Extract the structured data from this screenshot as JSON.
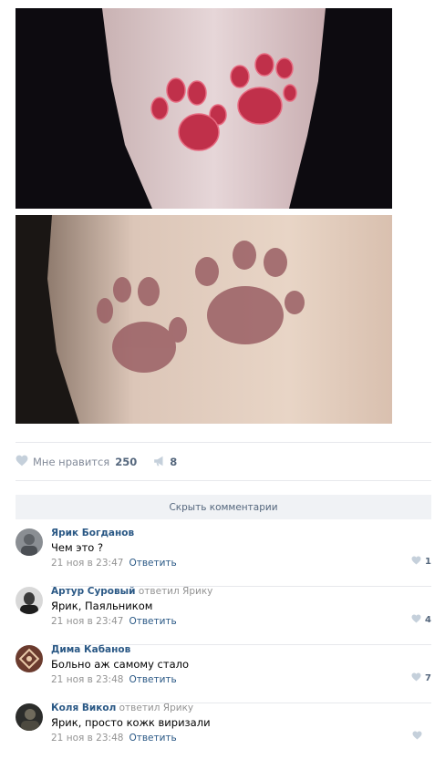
{
  "post": {
    "likes_label": "Мне нравится",
    "likes_count": "250",
    "shares_count": "8"
  },
  "comments_toggle": "Скрыть комментарии",
  "reply_label": "Ответить",
  "colors": {
    "link": "#2a5885",
    "muted": "#939393",
    "icon": "#c5d0db",
    "button_bg": "#f0f2f5"
  },
  "comments": [
    {
      "author": "Ярик Богданов",
      "replied_to": "",
      "text": "Чем это ?",
      "time": "21 ноя в 23:47",
      "likes": "1"
    },
    {
      "author": "Артур Суровый",
      "replied_to": "ответил Ярику",
      "text": "Ярик, Паяльником",
      "time": "21 ноя в 23:47",
      "likes": "4"
    },
    {
      "author": "Дима Кабанов",
      "replied_to": "",
      "text": "Больно аж самому стало",
      "time": "21 ноя в 23:48",
      "likes": "7"
    },
    {
      "author": "Коля Викол",
      "replied_to": "ответил Ярику",
      "text": "Ярик, просто кожк виризали",
      "time": "21 ноя в 23:48",
      "likes": ""
    }
  ]
}
